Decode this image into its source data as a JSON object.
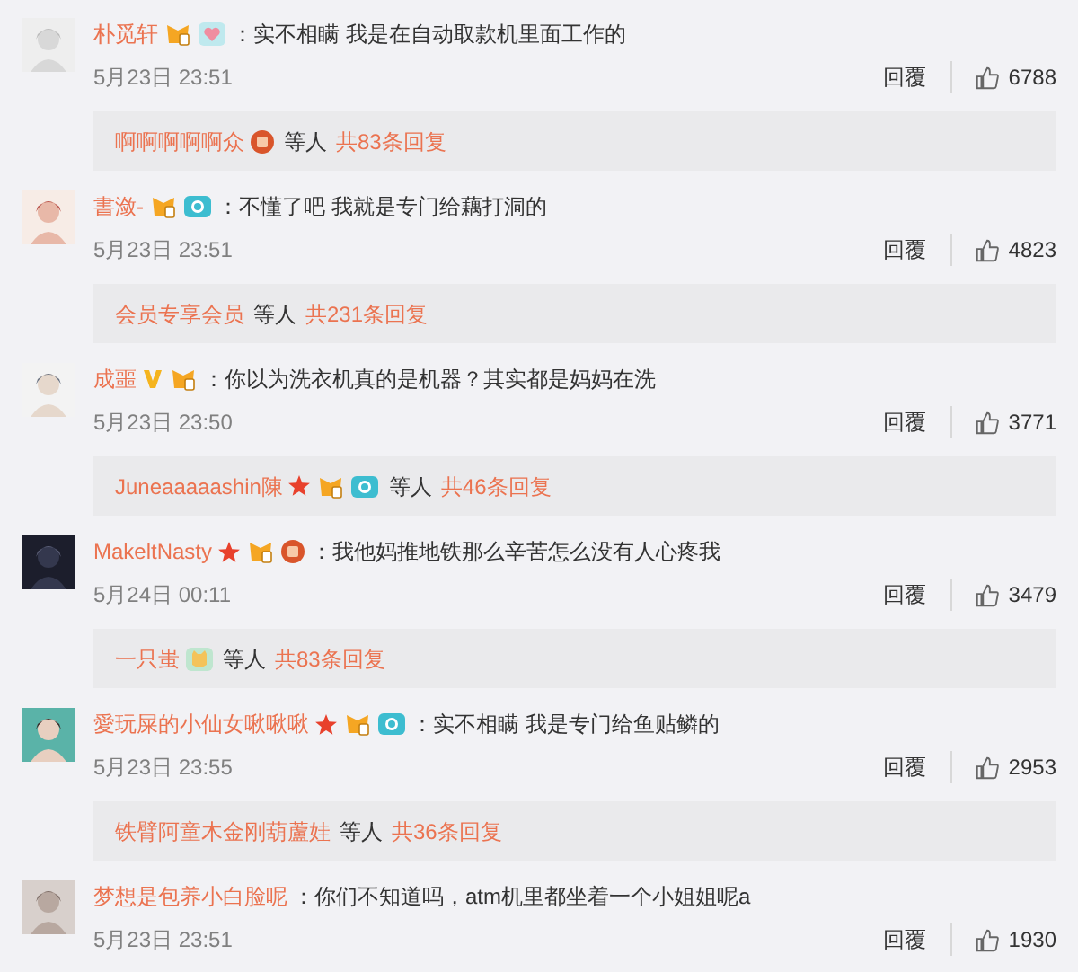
{
  "comments": [
    {
      "name": "朴觅轩",
      "badges": [
        {
          "kind": "vip"
        },
        {
          "kind": "heart"
        }
      ],
      "text": "：实不相瞒 我是在自动取款机里面工作的",
      "time": "5月23日 23:51",
      "reply_action": "回覆",
      "likes": "6788",
      "replies": {
        "names": [
          {
            "name": "啊啊啊啊啊众",
            "badges": [
              {
                "kind": "medal"
              }
            ]
          }
        ],
        "others": "等人",
        "count": "共83条回复"
      }
    },
    {
      "name": "書潋-",
      "badges": [
        {
          "kind": "vip"
        },
        {
          "kind": "camera"
        }
      ],
      "text": "：不懂了吧 我就是专门给藕打洞的",
      "time": "5月23日 23:51",
      "reply_action": "回覆",
      "likes": "4823",
      "replies": {
        "names": [
          {
            "name": "会员专享会员"
          }
        ],
        "others": "等人",
        "count": "共231条回复"
      }
    },
    {
      "name": "成噩",
      "badges": [
        {
          "kind": "v"
        },
        {
          "kind": "vip"
        }
      ],
      "text": "：你以为洗衣机真的是机器？其实都是妈妈在洗",
      "time": "5月23日 23:50",
      "reply_action": "回覆",
      "likes": "3771",
      "replies": {
        "names": [
          {
            "name": "Juneaaaaashin陳",
            "badges": [
              {
                "kind": "star"
              },
              {
                "kind": "vip"
              },
              {
                "kind": "camera"
              }
            ]
          }
        ],
        "others": "等人",
        "count": "共46条回复"
      }
    },
    {
      "name": "MakeltNasty",
      "badges": [
        {
          "kind": "star"
        },
        {
          "kind": "vip"
        },
        {
          "kind": "medal"
        }
      ],
      "text": "：我他妈推地铁那么辛苦怎么没有人心疼我",
      "time": "5月24日 00:11",
      "reply_action": "回覆",
      "likes": "3479",
      "replies": {
        "names": [
          {
            "name": "一只蚩",
            "badges": [
              {
                "kind": "cat"
              }
            ]
          }
        ],
        "others": "等人",
        "count": "共83条回复"
      }
    },
    {
      "name": "愛玩屎的小仙女啾啾啾",
      "badges": [
        {
          "kind": "star"
        },
        {
          "kind": "vip"
        },
        {
          "kind": "camera"
        }
      ],
      "text": "：实不相瞒 我是专门给鱼贴鳞的",
      "time": "5月23日 23:55",
      "reply_action": "回覆",
      "likes": "2953",
      "replies": {
        "names": [
          {
            "name": "铁臂阿童木金刚葫蘆娃"
          }
        ],
        "others": "等人",
        "count": "共36条回复"
      }
    },
    {
      "name": "梦想是包养小白脸呢",
      "text": "：你们不知道吗，atm机里都坐着一个小姐姐呢a",
      "time": "5月23日 23:51",
      "reply_action": "回覆",
      "likes": "1930"
    }
  ]
}
